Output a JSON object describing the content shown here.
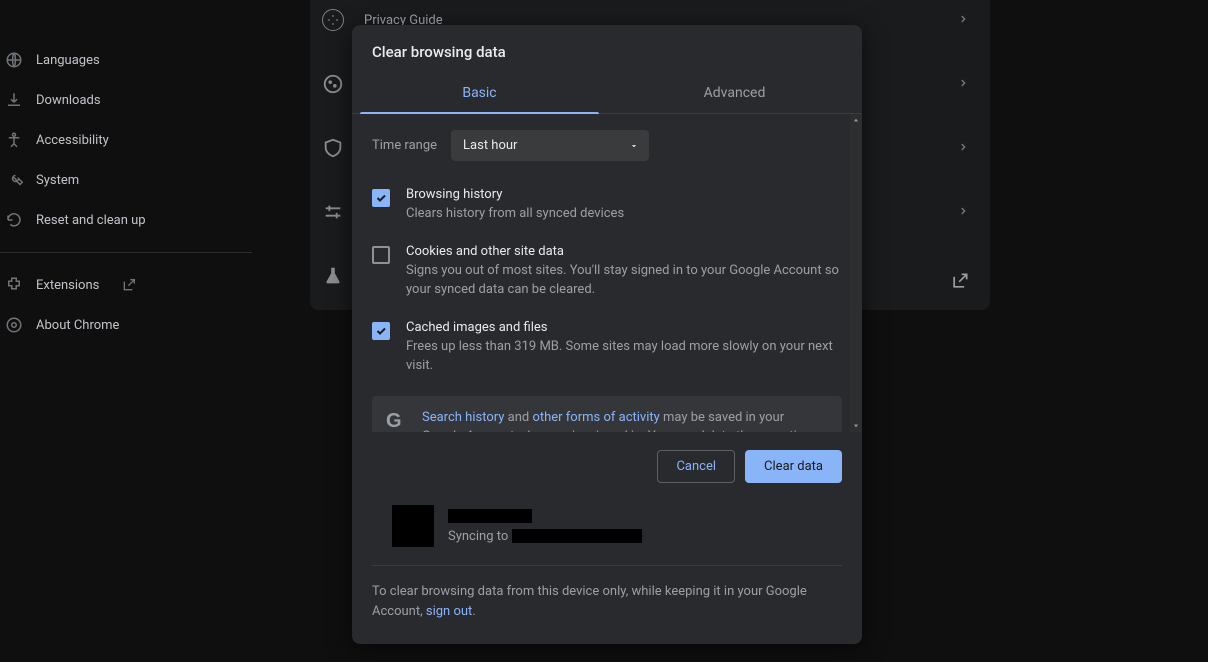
{
  "sidebar": {
    "items": [
      {
        "label": "Languages",
        "icon": "globe-icon"
      },
      {
        "label": "Downloads",
        "icon": "download-icon"
      },
      {
        "label": "Accessibility",
        "icon": "accessibility-icon"
      },
      {
        "label": "System",
        "icon": "wrench-icon"
      },
      {
        "label": "Reset and clean up",
        "icon": "reset-icon"
      }
    ],
    "extensions": "Extensions",
    "about": "About Chrome"
  },
  "background": {
    "row0": "Privacy Guide"
  },
  "dialog": {
    "title": "Clear browsing data",
    "tabs": {
      "basic": "Basic",
      "advanced": "Advanced"
    },
    "time_range_label": "Time range",
    "time_range_value": "Last hour",
    "items": [
      {
        "checked": true,
        "title": "Browsing history",
        "desc": "Clears history from all synced devices"
      },
      {
        "checked": false,
        "title": "Cookies and other site data",
        "desc": "Signs you out of most sites. You'll stay signed in to your Google Account so your synced data can be cleared."
      },
      {
        "checked": true,
        "title": "Cached images and files",
        "desc": "Frees up less than 319 MB. Some sites may load more slowly on your next visit."
      }
    ],
    "info": {
      "link1": "Search history",
      "mid": " and ",
      "link2": "other forms of activity",
      "rest": " may be saved in your Google Account when you're signed in. You can delete them anytime."
    },
    "cancel": "Cancel",
    "clear": "Clear data",
    "sync_prefix": "Syncing to ",
    "footnote_pre": "To clear browsing data from this device only, while keeping it in your Google Account, ",
    "footnote_link": "sign out",
    "footnote_post": "."
  }
}
